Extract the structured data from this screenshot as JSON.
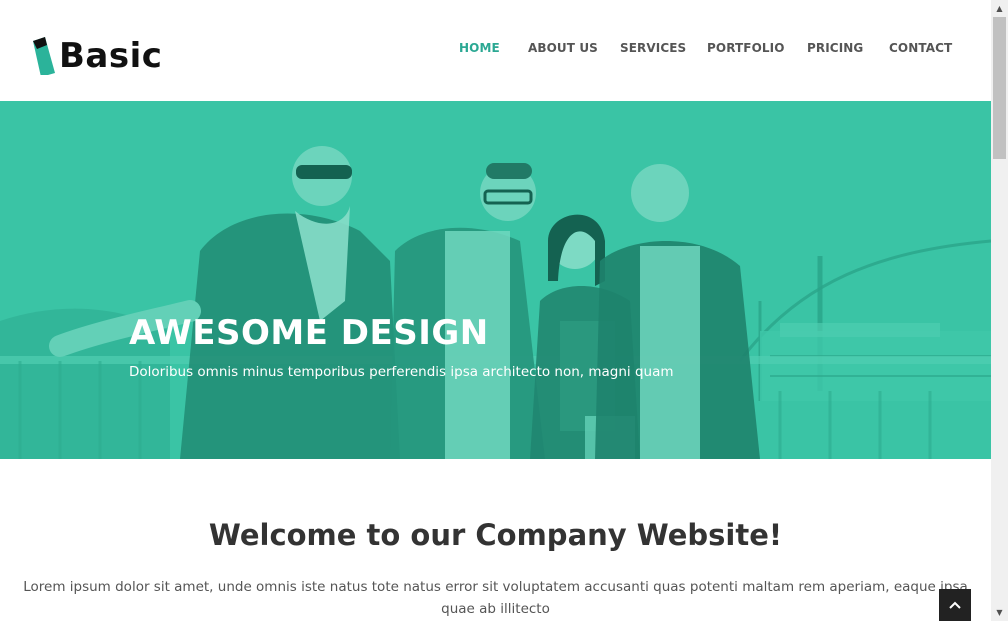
{
  "brand": {
    "name": "Basic",
    "logo_icon": "pennant-logo-icon",
    "accent": "#2bb39a"
  },
  "nav": {
    "items": [
      {
        "label": "HOME",
        "active": true
      },
      {
        "label": "ABOUT US",
        "active": false
      },
      {
        "label": "SERVICES",
        "active": false
      },
      {
        "label": "PORTFOLIO",
        "active": false
      },
      {
        "label": "PRICING",
        "active": false
      },
      {
        "label": "CONTACT",
        "active": false
      }
    ],
    "active_color": "#2ba893",
    "color": "#555555"
  },
  "hero": {
    "title": "AWESOME DESIGN",
    "subtitle": "Doloribus omnis minus temporibus perferendis ipsa architecto non, magni quam",
    "overlay_color": "#3cc4a5"
  },
  "welcome": {
    "title": "Welcome to our Company Website!",
    "text": "Lorem ipsum dolor sit amet, unde omnis iste natus tote natus error sit voluptatem accusanti quas potenti maltam rem aperiam, eaque ipsa quae ab illitecto"
  },
  "back_to_top": {
    "icon": "chevron-up-icon"
  },
  "scrollbar": {
    "up_icon": "scroll-up-arrow-icon",
    "down_icon": "scroll-down-arrow-icon"
  }
}
